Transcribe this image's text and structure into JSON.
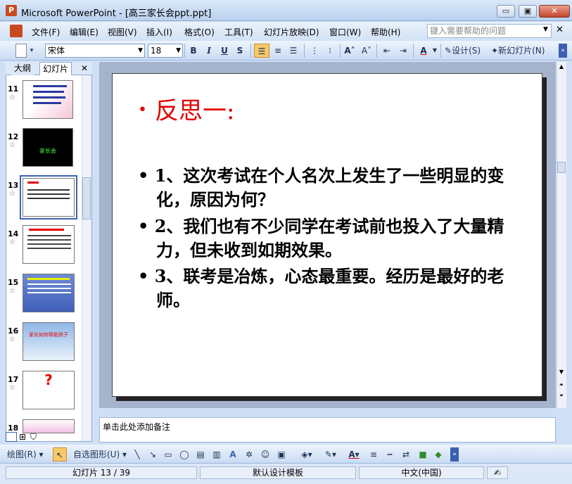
{
  "window": {
    "app_icon_glyph": "P",
    "title": "Microsoft PowerPoint - [高三家长会ppt.ppt]",
    "min": "▭",
    "max": "▣",
    "close": "✕"
  },
  "menu": {
    "items": [
      "文件(F)",
      "编辑(E)",
      "视图(V)",
      "插入(I)",
      "格式(O)",
      "工具(T)",
      "幻灯片放映(D)",
      "窗口(W)",
      "帮助(H)"
    ],
    "help_placeholder": "键入需要帮助的问题",
    "close_doc": "✕"
  },
  "toolbar": {
    "font_name": "宋体",
    "font_size": "18",
    "bold": "B",
    "italic": "I",
    "underline": "U",
    "shadow": "S",
    "design_label": "设计(S)",
    "new_slide_label": "新幻灯片(N)",
    "font_color_glyph": "A",
    "grow_font": "A˄",
    "shrink_font": "A˅"
  },
  "panel": {
    "tab_outline": "大纲",
    "tab_slides": "幻灯片",
    "close": "✕",
    "star": "☆",
    "thumbnails": [
      {
        "num": "11",
        "label": ""
      },
      {
        "num": "12",
        "label": "家长会"
      },
      {
        "num": "13",
        "label": ""
      },
      {
        "num": "14",
        "label": ""
      },
      {
        "num": "15",
        "label": ""
      },
      {
        "num": "16",
        "label": "家长如何帮助孩子"
      },
      {
        "num": "17",
        "label": "?"
      },
      {
        "num": "18",
        "label": ""
      }
    ]
  },
  "slide": {
    "title": "反思一:",
    "bullets": [
      "1、这次考试在个人名次上发生了一些明显的变化，原因为何？",
      "2、我们也有不少同学在考试前也投入了大量精力，但未收到如期效果。",
      "3、联考是冶炼，心态最重要。经历是最好的老师。"
    ],
    "bullet_glyph": "•"
  },
  "notes": {
    "placeholder": "单击此处添加备注"
  },
  "draw": {
    "draw_label": "绘图(R)",
    "autoshape_label": "自选图形(U)"
  },
  "status": {
    "slide": "幻灯片 13 / 39",
    "template": "默认设计模板",
    "lang": "中文(中国)"
  },
  "colors": {
    "title": "#e00000"
  }
}
